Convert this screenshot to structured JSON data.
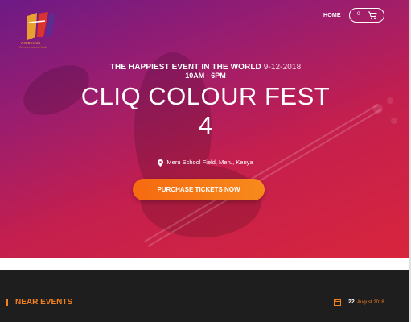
{
  "brand": {
    "name": "Art Events",
    "tagline": "Commercial and Stalls"
  },
  "nav": {
    "home_label": "HOME",
    "cart_count": "0",
    "cart_icon": "cart-icon"
  },
  "hero": {
    "tagline": "THE HAPPIEST EVENT IN THE WORLD",
    "date": "9-12-2018",
    "time": "10AM - 6PM",
    "title_line1": "CLIQ COLOUR FEST",
    "title_line2": "4",
    "venue": "Meru School Field, Meru, Kenya",
    "venue_icon": "map-pin-icon",
    "cta_label": "PURCHASE TICKETS NOW"
  },
  "events": {
    "heading": "NEAR EVENTS",
    "first": {
      "day": "22",
      "month_year": "August 2018",
      "icon": "calendar-icon"
    }
  },
  "colors": {
    "accent": "#f58220",
    "hero_start": "#6d1a86",
    "hero_end": "#d8253c",
    "dark_band": "#1e1e1e"
  }
}
